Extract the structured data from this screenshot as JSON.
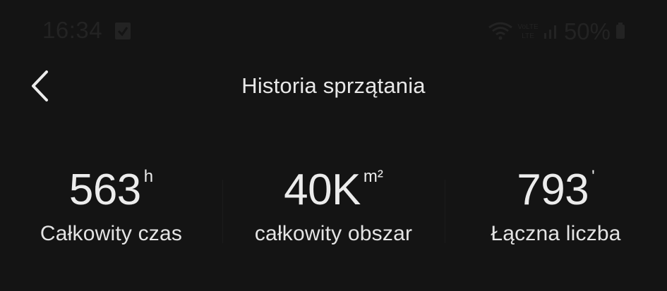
{
  "status_bar": {
    "time": "16:34",
    "notification_icon": "checkbox-icon",
    "wifi_icon": "wifi-icon",
    "volte_label": "VoLTE",
    "signal_icon": "signal-icon",
    "battery_text": "50%",
    "battery_icon": "battery-icon",
    "text_color": "#232323"
  },
  "header": {
    "title": "Historia sprzątania",
    "back_icon": "chevron-left-icon"
  },
  "stats": [
    {
      "value": "563",
      "unit": "h",
      "label": "Całkowity czas"
    },
    {
      "value": "40K",
      "unit": "m²",
      "label": "całkowity obszar"
    },
    {
      "value": "793",
      "unit": "'",
      "label": "Łączna liczba"
    }
  ],
  "colors": {
    "background": "#141414",
    "text": "#ececec"
  }
}
